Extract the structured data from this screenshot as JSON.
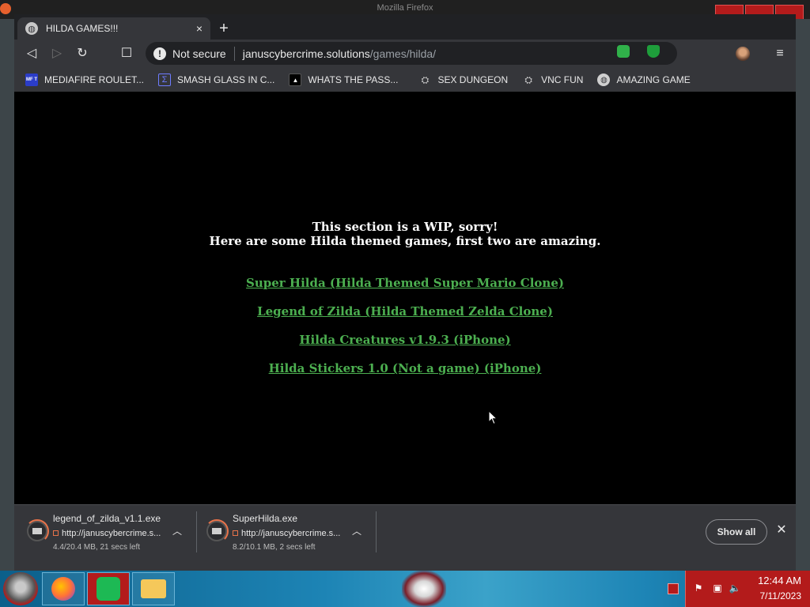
{
  "window": {
    "ghost_title": "Mozilla Firefox"
  },
  "tab": {
    "title": "HILDA GAMES!!!",
    "close": "×",
    "new_tab": "+"
  },
  "toolbar": {
    "back": "◁",
    "forward": "▷",
    "reload": "↻",
    "bookmark": "☐",
    "security_label": "Not secure",
    "url_host": "januscybercrime.solutions",
    "url_path": "/games/hilda/",
    "menu": "≡"
  },
  "bookmarks": [
    {
      "label": "MEDIAFIRE ROULET...",
      "icon": "mediafire-icon"
    },
    {
      "label": "SMASH GLASS IN C...",
      "icon": "smash-icon"
    },
    {
      "label": "WHATS THE PASS...",
      "icon": "whats-icon"
    },
    {
      "label": "SEX DUNGEON",
      "icon": "dungeon-icon"
    },
    {
      "label": "VNC FUN",
      "icon": "vnc-icon"
    },
    {
      "label": "AMAZING GAME",
      "icon": "globe-icon"
    }
  ],
  "page": {
    "line1": "This section is a WIP, sorry!",
    "line2": "Here are some Hilda themed games, first two are amazing.",
    "links": [
      "Super Hilda (Hilda Themed Super Mario Clone)",
      "Legend of Zilda (Hilda Themed Zelda Clone)",
      "Hilda Creatures v1.9.3 (iPhone)",
      "Hilda Stickers 1.0 (Not a game) (iPhone)"
    ],
    "link_color": "#4caf50"
  },
  "downloads": {
    "items": [
      {
        "filename": "legend_of_zilda_v1.1.exe",
        "url": "http://januscybercrime.s...",
        "status": "4.4/20.4 MB, 21 secs left"
      },
      {
        "filename": "SuperHilda.exe",
        "url": "http://januscybercrime.s...",
        "status": "8.2/10.1 MB, 2 secs left"
      }
    ],
    "show_all": "Show all",
    "close": "✕"
  },
  "taskbar": {
    "time": "12:44 AM",
    "date": "7/11/2023",
    "accent": "#b31b1b"
  }
}
